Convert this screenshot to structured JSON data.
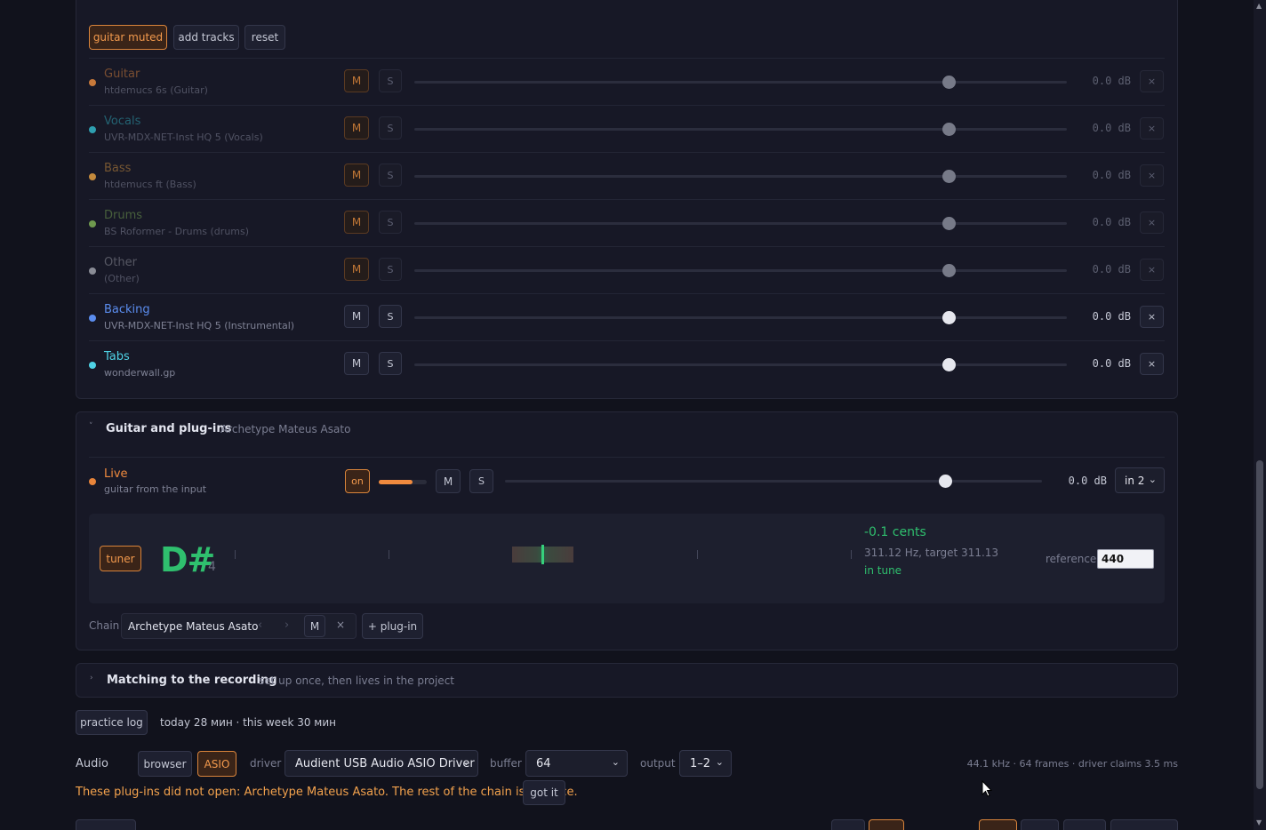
{
  "tracks_section": {
    "buttons": {
      "guitar_muted": "guitar muted",
      "add_tracks": "add tracks",
      "reset": "reset"
    },
    "rows": [
      {
        "name": "Guitar",
        "sub": "htdemucs 6s (Guitar)",
        "color": "#c8793a",
        "muted": true,
        "m": "M",
        "s": "S",
        "db": "0.0 dB",
        "x": "×",
        "level": 0.82
      },
      {
        "name": "Vocals",
        "sub": "UVR-MDX-NET-Inst HQ 5 (Vocals)",
        "color": "#2e9fb0",
        "muted": true,
        "m": "M",
        "s": "S",
        "db": "0.0 dB",
        "x": "×",
        "level": 0.82
      },
      {
        "name": "Bass",
        "sub": "htdemucs ft (Bass)",
        "color": "#c48a3c",
        "muted": true,
        "m": "M",
        "s": "S",
        "db": "0.0 dB",
        "x": "×",
        "level": 0.82
      },
      {
        "name": "Drums",
        "sub": "BS Roformer - Drums (drums)",
        "color": "#6f9a4e",
        "muted": true,
        "m": "M",
        "s": "S",
        "db": "0.0 dB",
        "x": "×",
        "level": 0.82
      },
      {
        "name": "Other",
        "sub": "(Other)",
        "color": "#8a8c96",
        "muted": true,
        "m": "M",
        "s": "S",
        "db": "0.0 dB",
        "x": "×",
        "level": 0.82
      },
      {
        "name": "Backing",
        "sub": "UVR-MDX-NET-Inst HQ 5 (Instrumental)",
        "color": "#5b8def",
        "muted": false,
        "m": "M",
        "s": "S",
        "db": "0.0 dB",
        "x": "×",
        "level": 0.82
      },
      {
        "name": "Tabs",
        "sub": "wonderwall.gp",
        "color": "#4fd3e6",
        "muted": false,
        "m": "M",
        "s": "S",
        "db": "0.0 dB",
        "x": "×",
        "level": 0.82
      }
    ]
  },
  "guitar_section": {
    "title": "Guitar and plug-ins",
    "subtitle": "Archetype Mateus Asato",
    "caret": "˅",
    "live": {
      "name": "Live",
      "sub": "guitar from the input",
      "on": "on",
      "m": "M",
      "s": "S",
      "db": "0.0 dB",
      "input": "in 2",
      "input_level": 0.7,
      "level": 0.82
    },
    "tuner": {
      "button": "tuner",
      "note": "D#",
      "octave": "4",
      "cents": "-0.1 cents",
      "freq": "311.12 Hz, target 311.13",
      "status": "in tune",
      "reference_label": "reference",
      "reference_value": "440"
    },
    "chain": {
      "label": "Chain",
      "plugin": "Archetype Mateus Asato",
      "prev": "‹",
      "next": "›",
      "m": "M",
      "x": "×",
      "add": "+ plug-in"
    }
  },
  "matching_section": {
    "caret": "›",
    "title": "Matching to the recording",
    "subtitle": "set up once, then lives in the project"
  },
  "practice": {
    "button": "practice log",
    "summary": "today 28 мин · this week 30 мин"
  },
  "audio": {
    "label": "Audio",
    "browser": "browser",
    "asio": "ASIO",
    "driver_label": "driver",
    "driver_value": "Audient USB Audio ASIO Driver",
    "buffer_label": "buffer",
    "buffer_value": "64",
    "output_label": "output",
    "output_value": "1–2",
    "stats": "44.1 kHz · 64 frames · driver claims 3.5 ms",
    "warning": "These plug-ins did not open: Archetype Mateus Asato. The rest of the chain is in place.",
    "got_it": "got it"
  },
  "colors": {
    "accent_orange": "#f39a4d",
    "tune_green": "#2fbf6e",
    "background": "#11121c"
  }
}
